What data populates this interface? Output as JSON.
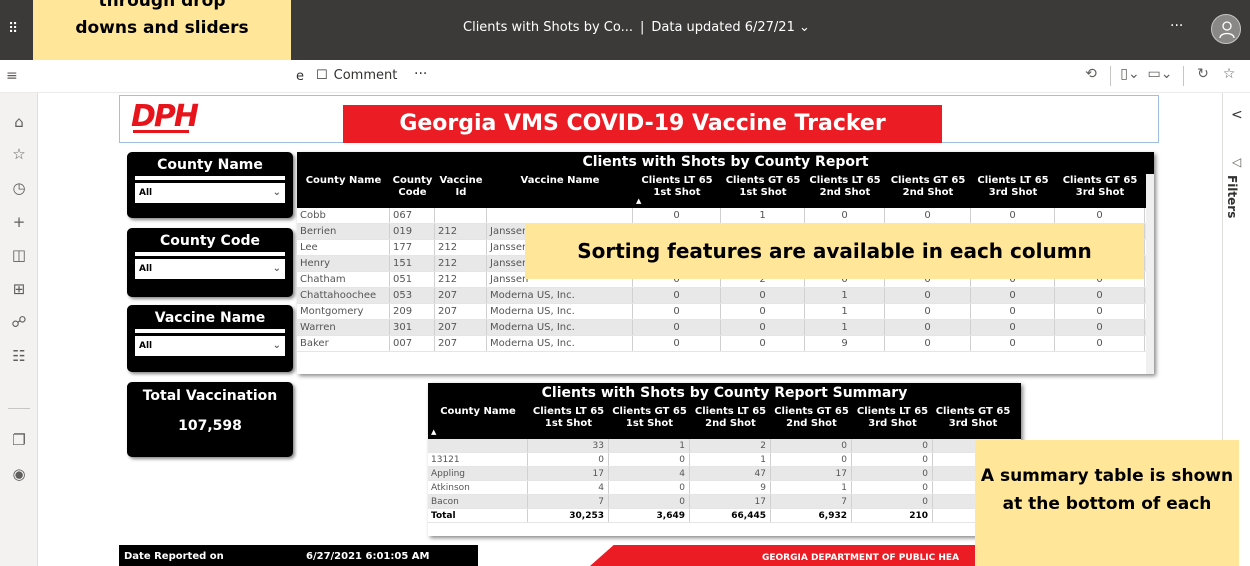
{
  "topbar": {
    "report_name": "Clients with Shots by Co...",
    "data_updated": "Data updated 6/27/21",
    "more": "···"
  },
  "actionbar": {
    "edit_fragment": "e",
    "comment_label": "Comment",
    "more": "···"
  },
  "filters_pane": {
    "label": "Filters"
  },
  "report": {
    "title": "Georgia VMS COVID-19 Vaccine Tracker",
    "logo_text": "DPH"
  },
  "slicers": [
    {
      "title": "County Name",
      "value": "All"
    },
    {
      "title": "County Code",
      "value": "All"
    },
    {
      "title": "Vaccine Name",
      "value": "All"
    }
  ],
  "total_card": {
    "title": "Total Vaccination",
    "value": "107,598"
  },
  "main_table": {
    "title": "Clients with Shots by County Report",
    "headers": [
      "County Name",
      "County Code",
      "Vaccine Id",
      "Vaccine Name",
      "Clients LT 65 1st Shot",
      "Clients GT 65 1st Shot",
      "Clients LT 65 2nd Shot",
      "Clients GT 65 2nd Shot",
      "Clients LT 65 3rd Shot",
      "Clients GT 65 3rd Shot"
    ],
    "rows": [
      [
        "Cobb",
        "067",
        "",
        "",
        "0",
        "1",
        "0",
        "0",
        "0",
        "0"
      ],
      [
        "Berrien",
        "019",
        "212",
        "Janssen",
        "",
        "",
        "",
        "",
        "",
        ""
      ],
      [
        "Lee",
        "177",
        "212",
        "Janssen",
        "",
        "",
        "",
        "",
        "",
        ""
      ],
      [
        "Henry",
        "151",
        "212",
        "Janssen",
        "",
        "",
        "",
        "",
        "",
        ""
      ],
      [
        "Chatham",
        "051",
        "212",
        "Janssen",
        "0",
        "2",
        "0",
        "0",
        "0",
        "0"
      ],
      [
        "Chattahoochee",
        "053",
        "207",
        "Moderna US, Inc.",
        "0",
        "0",
        "1",
        "0",
        "0",
        "0"
      ],
      [
        "Montgomery",
        "209",
        "207",
        "Moderna US, Inc.",
        "0",
        "0",
        "1",
        "0",
        "0",
        "0"
      ],
      [
        "Warren",
        "301",
        "207",
        "Moderna US, Inc.",
        "0",
        "0",
        "1",
        "0",
        "0",
        "0"
      ],
      [
        "Baker",
        "007",
        "207",
        "Moderna US, Inc.",
        "0",
        "0",
        "9",
        "0",
        "0",
        "0"
      ]
    ]
  },
  "summary_table": {
    "title": "Clients with Shots by County Report Summary",
    "headers": [
      "County Name",
      "Clients LT 65 1st Shot",
      "Clients GT 65 1st Shot",
      "Clients LT 65 2nd Shot",
      "Clients GT 65 2nd Shot",
      "Clients LT 65 3rd Shot",
      "Clients GT 65 3rd Shot"
    ],
    "rows": [
      [
        "",
        "33",
        "1",
        "2",
        "0",
        "0",
        ""
      ],
      [
        "13121",
        "0",
        "0",
        "1",
        "0",
        "0",
        ""
      ],
      [
        "Appling",
        "17",
        "4",
        "47",
        "17",
        "0",
        ""
      ],
      [
        "Atkinson",
        "4",
        "0",
        "9",
        "1",
        "0",
        ""
      ],
      [
        "Bacon",
        "7",
        "0",
        "17",
        "7",
        "0",
        ""
      ]
    ],
    "total": [
      "Total",
      "30,253",
      "3,649",
      "66,445",
      "6,932",
      "210",
      ""
    ]
  },
  "footer": {
    "date_label": "Date Reported on",
    "date_value": "6/27/2021 6:01:05 AM",
    "org": "GEORGIA DEPARTMENT OF PUBLIC HEA"
  },
  "callouts": {
    "top_line1": "through drop",
    "top_line2": "downs and sliders",
    "sorting": "Sorting features are available in each column",
    "summary": "A summary table is shown at the bottom of each"
  }
}
